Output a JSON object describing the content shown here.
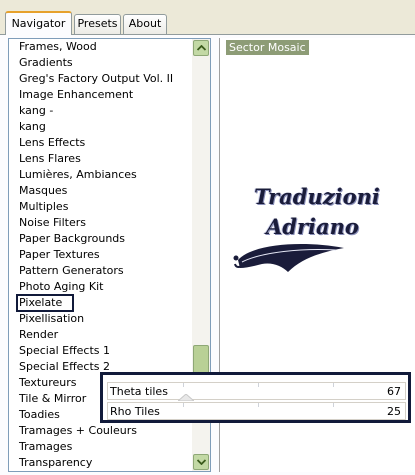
{
  "tabs": [
    "Navigator",
    "Presets",
    "About"
  ],
  "list_items": [
    "Frames, Wood",
    "Gradients",
    "Greg's Factory Output Vol. II",
    "Image Enhancement",
    "kang -",
    "kang",
    "Lens Effects",
    "Lens Flares",
    "Lumières, Ambiances",
    "Masques",
    "Multiples",
    "Noise Filters",
    "Paper Backgrounds",
    "Paper Textures",
    "Pattern Generators",
    "Photo Aging Kit",
    "Pixelate",
    "Pixellisation",
    "Render",
    "Special Effects 1",
    "Special Effects 2",
    "Textureurs",
    "Tile & Mirror",
    "Toadies",
    "Tramages + Couleurs",
    "Tramages",
    "Transparency"
  ],
  "selected_item": "Pixelate",
  "preview": {
    "filter_name": "Sector Mosaic",
    "watermark_line1": "Traduzioni",
    "watermark_line2": "Adriano"
  },
  "sliders": [
    {
      "label": "Theta tiles",
      "value": "67"
    },
    {
      "label": "Rho Tiles",
      "value": "25"
    }
  ],
  "icons": {
    "scroll_up": "chevron-up-icon",
    "scroll_down": "chevron-down-icon"
  },
  "colors": {
    "tab_active_accent": "#e6a12c",
    "scrollbar_green": "#c3d9a5",
    "preview_label_bg": "#8d9c76",
    "highlight_border": "#111a3a"
  }
}
